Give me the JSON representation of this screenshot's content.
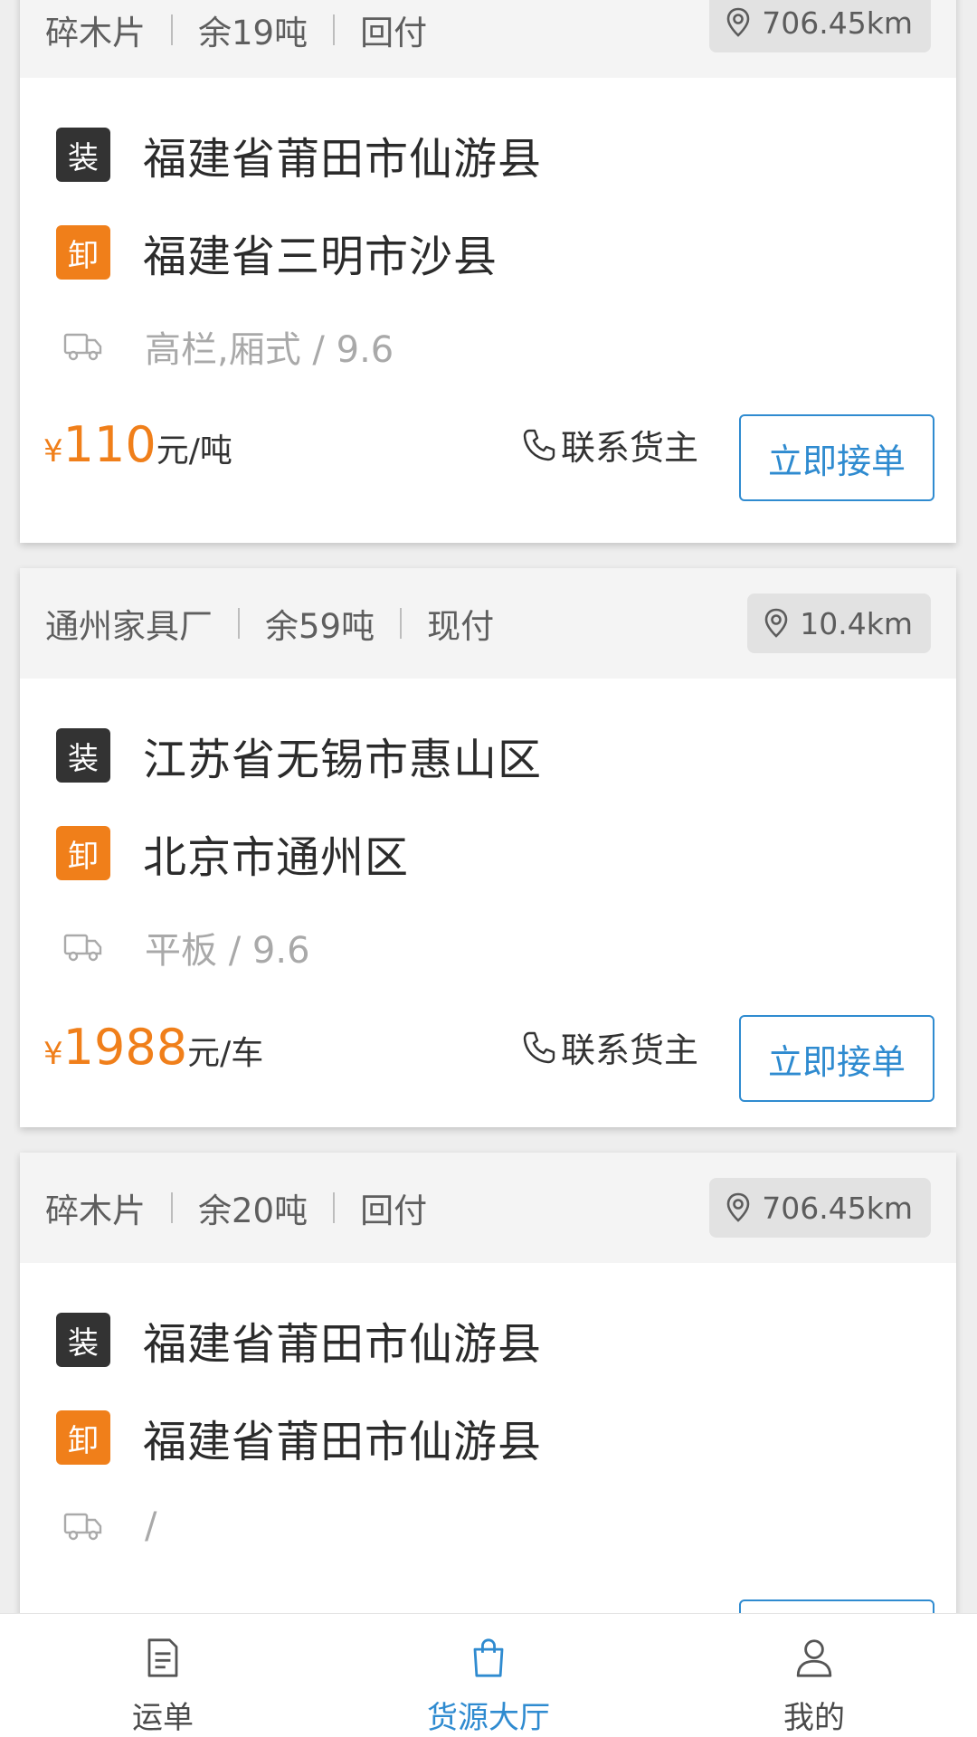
{
  "cards": [
    {
      "meta": [
        "碎木片",
        "余19吨",
        "回付"
      ],
      "distance": "706.45km",
      "load_tag": "装",
      "load_address": "福建省莆田市仙游县",
      "unload_tag": "卸",
      "unload_address": "福建省三明市沙县",
      "truck": "高栏,厢式 / 9.6",
      "price_currency": "¥",
      "price_value": "110",
      "price_unit": "元/吨",
      "contact_label": "联系货主",
      "accept_label": "立即接单"
    },
    {
      "meta": [
        "通州家具厂",
        "余59吨",
        "现付"
      ],
      "distance": "10.4km",
      "load_tag": "装",
      "load_address": "江苏省无锡市惠山区",
      "unload_tag": "卸",
      "unload_address": "北京市通州区",
      "truck": "平板 / 9.6",
      "price_currency": "¥",
      "price_value": "1988",
      "price_unit": "元/车",
      "contact_label": "联系货主",
      "accept_label": "立即接单"
    },
    {
      "meta": [
        "碎木片",
        "余20吨",
        "回付"
      ],
      "distance": "706.45km",
      "load_tag": "装",
      "load_address": "福建省莆田市仙游县",
      "unload_tag": "卸",
      "unload_address": "福建省莆田市仙游县",
      "truck": "/"
    }
  ],
  "tabbar": {
    "items": [
      {
        "label": "运单",
        "icon": "document-icon"
      },
      {
        "label": "货源大厅",
        "icon": "bag-icon",
        "active": true
      },
      {
        "label": "我的",
        "icon": "user-icon"
      }
    ]
  },
  "colors": {
    "accent": "#2f8bd0",
    "price": "#f07f1a",
    "load_tag": "#333333",
    "unload_tag": "#f07f1a"
  }
}
